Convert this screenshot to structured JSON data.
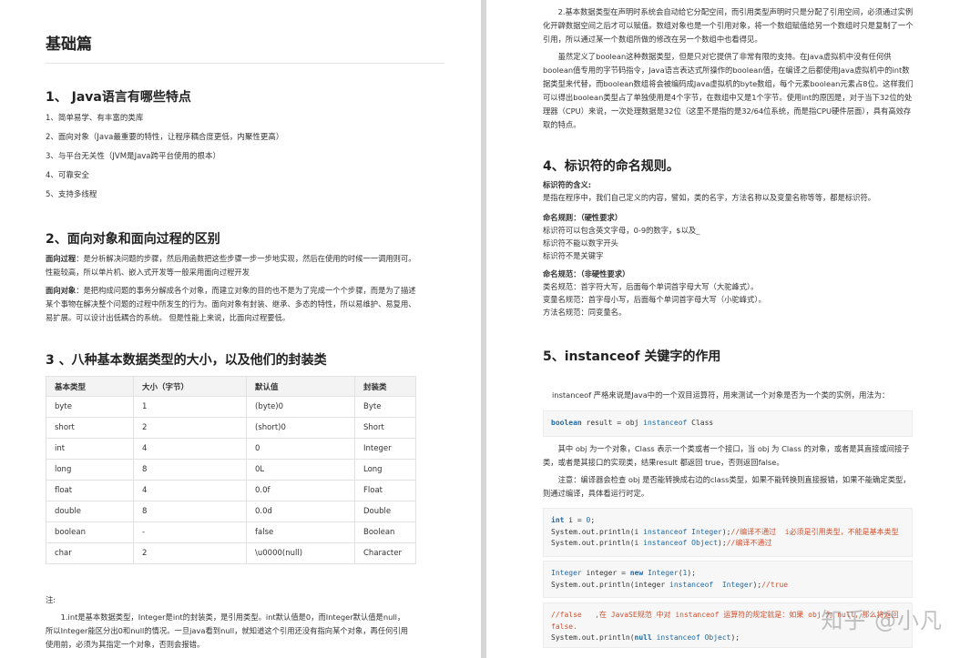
{
  "left": {
    "title": "基础篇",
    "q1": {
      "heading": "1、 Java语言有哪些特点",
      "items": [
        "1、简单易学、有丰富的类库",
        "2、面向对象（Java最重要的特性，让程序耦合度更低，内聚性更高）",
        "3、与平台无关性（JVM是Java跨平台使用的根本）",
        "4、可靠安全",
        "5、支持多线程"
      ]
    },
    "q2": {
      "heading": "2、面向对象和面向过程的区别",
      "p1_label": "面向过程",
      "p1_text": "：是分析解决问题的步骤，然后用函数把这些步骤一步一步地实现，然后在使用的时候一一调用则可。性能较高，所以单片机、嵌入式开发等一般采用面向过程开发",
      "p2_label": "面向对象",
      "p2_text": "：是把构成问题的事务分解成各个对象，而建立对象的目的也不是为了完成一个个步骤，而是为了描述某个事物在解决整个问题的过程中所发生的行为。面向对象有封装、继承、多态的特性，所以易维护、易复用、易扩展。可以设计出低耦合的系统。 但是性能上来说，比面向过程要低。"
    },
    "q3": {
      "heading": "3 、八种基本数据类型的大小，以及他们的封装类",
      "columns": [
        "基本类型",
        "大小（字节）",
        "默认值",
        "封装类"
      ],
      "rows": [
        [
          "byte",
          "1",
          "(byte)0",
          "Byte"
        ],
        [
          "short",
          "2",
          "(short)0",
          "Short"
        ],
        [
          "int",
          "4",
          "0",
          "Integer"
        ],
        [
          "long",
          "8",
          "0L",
          "Long"
        ],
        [
          "float",
          "4",
          "0.0f",
          "Float"
        ],
        [
          "double",
          "8",
          "0.0d",
          "Double"
        ],
        [
          "boolean",
          "-",
          "false",
          "Boolean"
        ],
        [
          "char",
          "2",
          "\\u0000(null)",
          "Character"
        ]
      ]
    },
    "note_label": "注:",
    "note_text": "1.int是基本数据类型，Integer是int的封装类，是引用类型。int默认值是0，而Integer默认值是null，所以Integer能区分出0和null的情况。一旦java看到null，就知道这个引用还没有指向某个对象，再任何引用使用前，必须为其指定一个对象，否则会报错。"
  },
  "right": {
    "p_array": "2.基本数据类型在声明时系统会自动给它分配空间，而引用类型声明时只是分配了引用空间，必须通过实例化开辟数据空间之后才可以赋值。数组对象也是一个引用对象，将一个数组赋值给另一个数组时只是复制了一个引用，所以通过某一个数组所做的修改在另一个数组中也看得见。",
    "p_boolean": "虽然定义了boolean这种数据类型，但是只对它提供了非常有限的支持。在Java虚拟机中没有任何供boolean值专用的字节码指令，Java语言表达式所操作的boolean值，在编译之后都使用Java虚拟机中的int数据类型来代替，而boolean数组将会被编码成Java虚拟机的byte数组，每个元素boolean元素占8位。这样我们可以得出boolean类型占了单独使用是4个字节，在数组中又是1个字节。使用int的原因是，对于当下32位的处理器（CPU）来说，一次处理数据是32位（这里不是指的是32/64位系统，而是指CPU硬件层面），具有高效存取的特点。",
    "q4": {
      "heading": "4、标识符的命名规则。",
      "meaning_label": "标识符的含义:",
      "meaning_text": "是指在程序中，我们自己定义的内容，譬如，类的名字，方法名称以及变量名称等等，都是标识符。",
      "rule_label": "命名规则：（硬性要求）",
      "rules": [
        "标识符可以包含英文字母，0-9的数字，$以及_",
        "标识符不能以数字开头",
        "标识符不是关键字"
      ],
      "spec_label": "命名规范：（非硬性要求）",
      "specs": [
        "类名规范：首字符大写，后面每个单词首字母大写（大驼峰式）。",
        "变量名规范：首字母小写，后面每个单词首字母大写（小驼峰式）。",
        "方法名规范：同变量名。"
      ]
    },
    "q5": {
      "heading": "5、instanceof 关键字的作用",
      "intro": "instanceof 严格来说是Java中的一个双目运算符，用来测试一个对象是否为一个类的实例，用法为：",
      "code1": {
        "kw": "boolean",
        "rest": " result = obj ",
        "kw2": "instanceof",
        "tail": " Class"
      },
      "p1": "其中 obj 为一个对象，Class 表示一个类或者一个接口，当 obj 为 Class 的对象，或者是其直接或间接子类，或者是其接口的实现类，结果result 都返回 true，否则返回false。",
      "p2": "注意：编译器会检查 obj 是否能转换成右边的class类型，如果不能转换则直接报错，如果不能确定类型，则通过编译，具体看运行时定。",
      "code2": {
        "l1_kw": "int",
        "l1_rest": " i = ",
        "l1_num": "0",
        "l1_end": ";",
        "l2_a": "System.out.println(i ",
        "l2_kw": "instanceof",
        "l2_cls": " Integer",
        "l2_b": ");",
        "l2_cm": "//编译不通过  i必须是引用类型，不能是基本类型",
        "l3_a": "System.out.println(i ",
        "l3_kw": "instanceof",
        "l3_cls": " Object",
        "l3_b": ");",
        "l3_cm": "//编译不通过"
      },
      "code3": {
        "l1_cls": "Integer",
        "l1_a": " integer = ",
        "l1_kw": "new",
        "l1_cls2": " Integer",
        "l1_b": "(",
        "l1_num": "1",
        "l1_c": ");",
        "l2_a": "System.out.println(integer ",
        "l2_kw": "instanceof",
        "l2_cls": "  Integer",
        "l2_b": ");",
        "l2_cm": "//true"
      },
      "code4": {
        "l1_cm": "//false   ,在 JavaSE规范 中对 instanceof 运算符的规定就是：如果 obj 为 null，那么将返回",
        "l2_kw": "false.",
        "l3_a": "System.out.println(",
        "l3_kw": "null",
        "l3_kw2": " instanceof",
        "l3_cls": " Object",
        "l3_b": ");"
      }
    }
  },
  "watermark": "知乎 @小凡"
}
